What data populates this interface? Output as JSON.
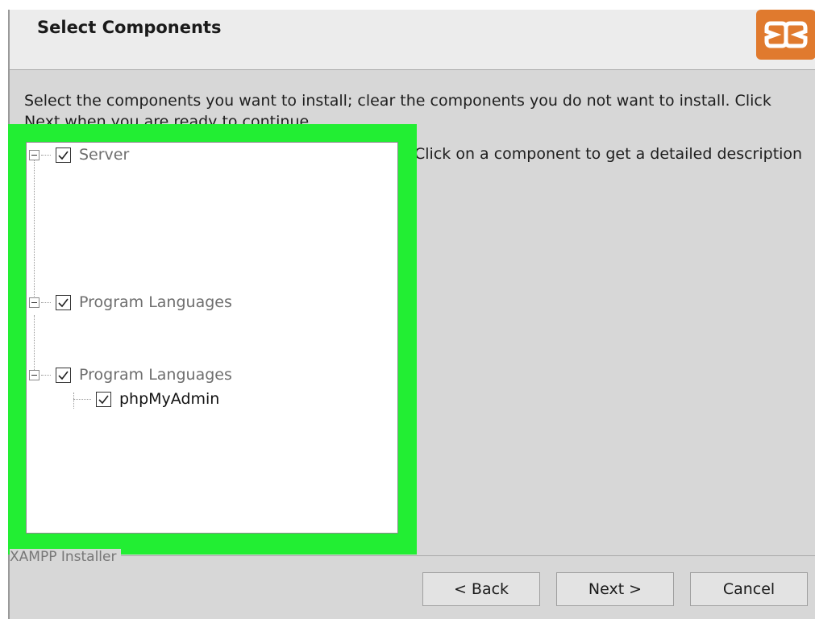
{
  "header": {
    "title": "Select Components"
  },
  "instructions": "Select the components you want to install; clear the components you do not want to install. Click Next when you are ready to continue.",
  "description_hint": "Click on a component to get a detailed description",
  "tree": {
    "items": [
      {
        "label": "Server",
        "checked": true,
        "level": 0
      },
      {
        "label": "Program Languages",
        "checked": true,
        "level": 0
      },
      {
        "label": "Program Languages",
        "checked": true,
        "level": 0
      },
      {
        "label": "phpMyAdmin",
        "checked": true,
        "level": 1
      }
    ]
  },
  "footer": {
    "installer_label": "XAMPP Installer",
    "back_label": "< Back",
    "next_label": "Next >",
    "cancel_label": "Cancel"
  },
  "colors": {
    "highlight": "#22ee33",
    "logo": "#e07a2e"
  },
  "icons": {
    "logo": "xampp-logo-icon",
    "expander": "collapse-icon",
    "check": "checkbox-checked-icon"
  }
}
